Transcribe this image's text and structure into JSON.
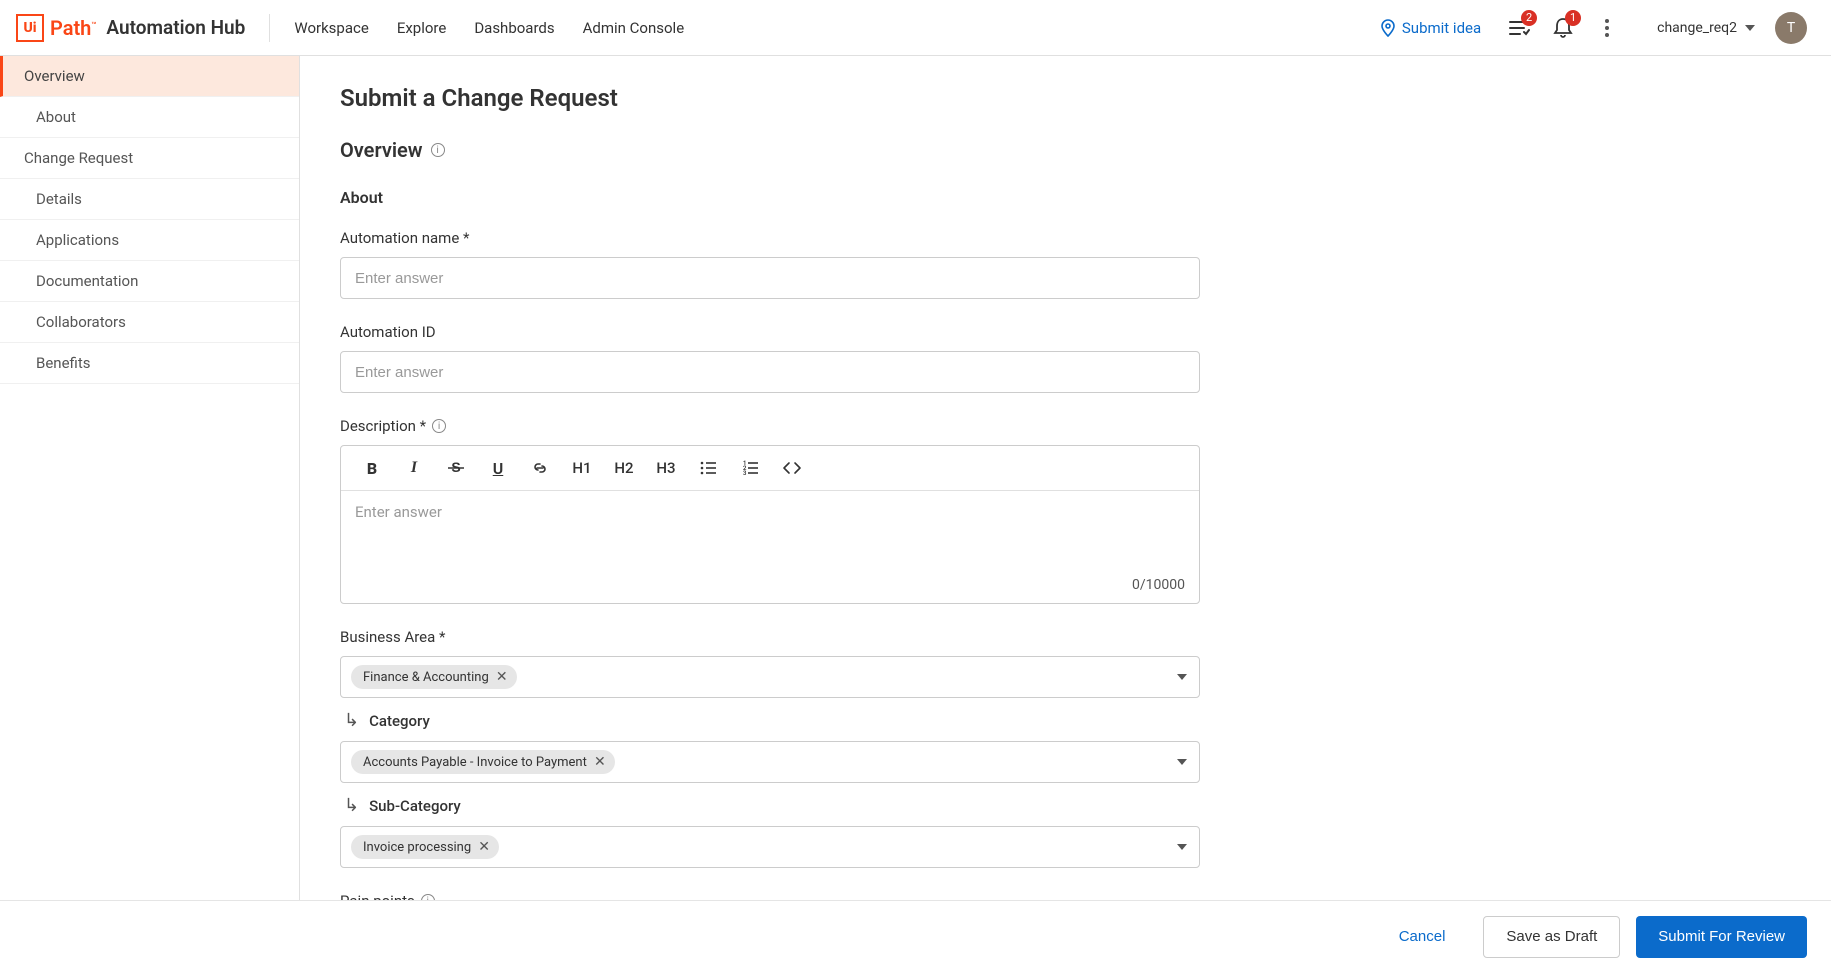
{
  "header": {
    "logo_prefix": "Ui",
    "logo_suffix": "Path",
    "logo_hub": "Automation Hub",
    "nav": [
      "Workspace",
      "Explore",
      "Dashboards",
      "Admin Console"
    ],
    "submit_idea": "Submit idea",
    "tasks_badge": "2",
    "notif_badge": "1",
    "username": "change_req2",
    "avatar_initial": "T"
  },
  "sidebar": {
    "items": [
      {
        "label": "Overview",
        "active": true,
        "indent": false
      },
      {
        "label": "About",
        "active": false,
        "indent": true
      },
      {
        "label": "Change Request",
        "active": false,
        "indent": false
      },
      {
        "label": "Details",
        "active": false,
        "indent": true
      },
      {
        "label": "Applications",
        "active": false,
        "indent": true
      },
      {
        "label": "Documentation",
        "active": false,
        "indent": true
      },
      {
        "label": "Collaborators",
        "active": false,
        "indent": true
      },
      {
        "label": "Benefits",
        "active": false,
        "indent": true
      }
    ]
  },
  "page": {
    "title": "Submit a Change Request",
    "section": "Overview",
    "subsection": "About",
    "fields": {
      "automation_name": {
        "label": "Automation name *",
        "placeholder": "Enter answer",
        "value": ""
      },
      "automation_id": {
        "label": "Automation ID",
        "placeholder": "Enter answer",
        "value": ""
      },
      "description": {
        "label": "Description *",
        "placeholder": "Enter answer",
        "counter": "0/10000"
      },
      "business_area": {
        "label": "Business Area *",
        "chips": [
          "Finance & Accounting"
        ]
      },
      "category": {
        "label": "Category",
        "chips": [
          "Accounts Payable - Invoice to Payment"
        ]
      },
      "sub_category": {
        "label": "Sub-Category",
        "chips": [
          "Invoice processing"
        ]
      },
      "pain_points": {
        "label": "Pain points"
      }
    },
    "rte_toolbar": {
      "bold": "B",
      "italic": "I",
      "strike": "S",
      "underline": "U",
      "link": "link",
      "h1": "H1",
      "h2": "H2",
      "h3": "H3",
      "ul": "ul",
      "ol": "ol",
      "code": "<>"
    }
  },
  "footer": {
    "cancel": "Cancel",
    "save_draft": "Save as Draft",
    "submit": "Submit For Review"
  }
}
